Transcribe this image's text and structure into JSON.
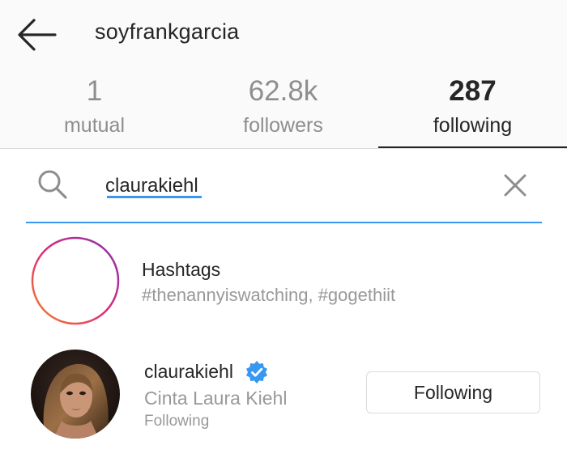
{
  "header": {
    "username": "soyfrankgarcia",
    "back_icon": "arrow-left-icon"
  },
  "tabs": [
    {
      "count": "1",
      "label": "mutual",
      "active": false
    },
    {
      "count": "62.8k",
      "label": "followers",
      "active": false
    },
    {
      "count": "287",
      "label": "following",
      "active": true
    }
  ],
  "search": {
    "value": "claurakiehl",
    "search_icon": "magnifier-icon",
    "clear_icon": "close-icon",
    "accent_color": "#3897f0"
  },
  "results": {
    "hashtags": {
      "title": "Hashtags",
      "subtitle": "#thenannyiswatching, #gogethiit",
      "icon": "hashtag-icon"
    },
    "user": {
      "username": "claurakiehl",
      "verified": true,
      "full_name": "Cinta Laura Kiehl",
      "status": "Following",
      "button_label": "Following",
      "badge_color": "#3897f0"
    }
  }
}
